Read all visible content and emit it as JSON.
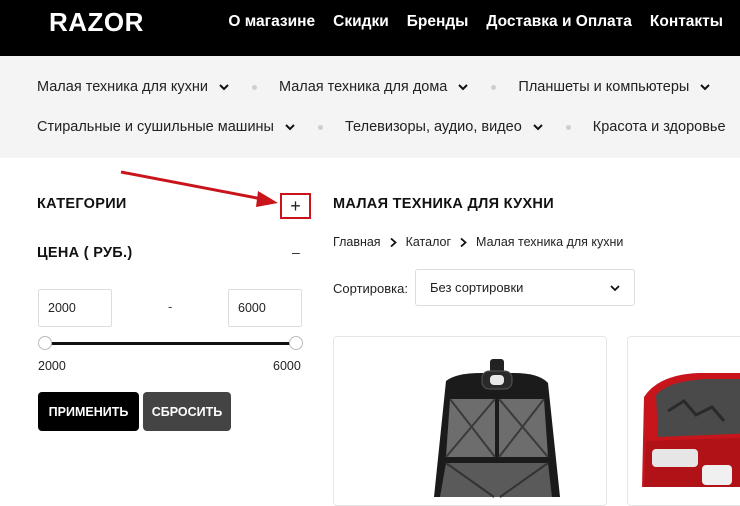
{
  "header": {
    "logo": "RAZOR",
    "nav": [
      "О магазине",
      "Скидки",
      "Бренды",
      "Доставка и Оплата",
      "Контакты"
    ]
  },
  "categories_bar": {
    "row1": [
      "Малая техника для кухни",
      "Малая техника для дома",
      "Планшеты и компьютеры"
    ],
    "row2": [
      "Стиральные и сушильные машины",
      "Телевизоры, аудио, видео",
      "Красота и здоровье"
    ]
  },
  "sidebar": {
    "categories_title": "КАТЕГОРИИ",
    "categories_toggle": "+",
    "price_title": "ЦЕНА ( РУБ.)",
    "price_toggle": "–",
    "price_from": "2000",
    "price_to": "6000",
    "range_separator": "-",
    "range_min_label": "2000",
    "range_max_label": "6000",
    "slider_low_fraction": 0,
    "slider_high_fraction": 1,
    "apply_button": "ПРИМЕНИТЬ",
    "reset_button": "СБРОСИТЬ"
  },
  "main": {
    "title": "МАЛАЯ ТЕХНИКА ДЛЯ КУХНИ",
    "breadcrumb": [
      "Главная",
      "Каталог",
      "Малая техника для кухни"
    ],
    "sort_label": "Сортировка:",
    "sort_value": "Без сортировки"
  },
  "colors": {
    "header_bg": "#000000",
    "accent_red": "#c8141a",
    "apply_button_bg": "#000000",
    "reset_button_bg": "#444444"
  }
}
